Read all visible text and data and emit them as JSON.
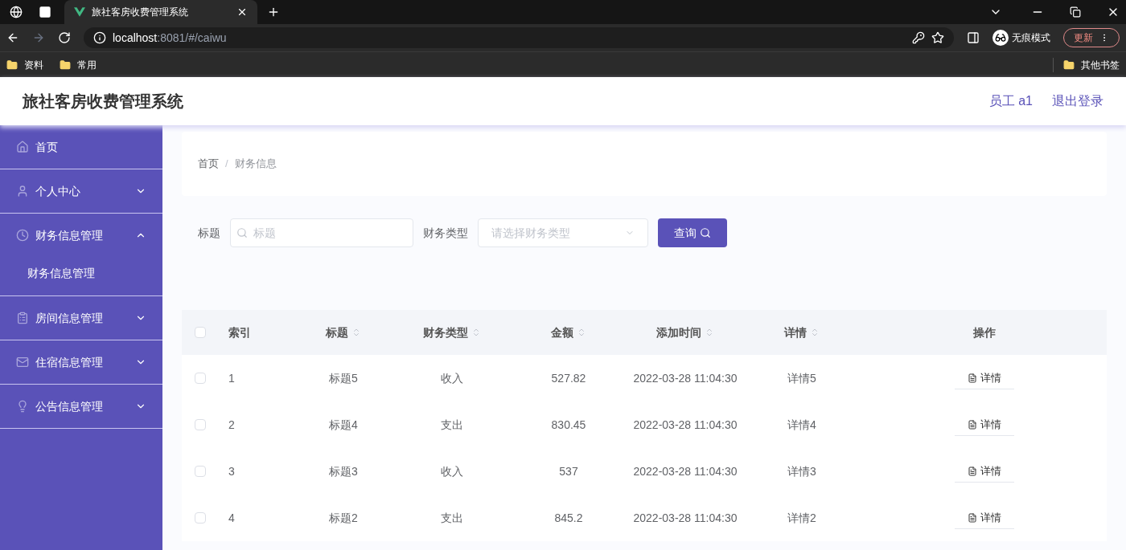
{
  "browser": {
    "tab_title": "旅社客房收费管理系统",
    "address": {
      "host": "localhost",
      "path": ":8081/#/caiwu"
    },
    "profile": "无痕模式",
    "update": "更新",
    "bookmarks": [
      "资料",
      "常用"
    ],
    "other_bookmarks": "其他书签"
  },
  "header": {
    "title": "旅社客房收费管理系统",
    "user": "员工 a1",
    "logout": "退出登录"
  },
  "sidebar": {
    "items": [
      {
        "label": "首页",
        "kind": "link"
      },
      {
        "label": "个人中心",
        "kind": "submenu",
        "expanded": false
      },
      {
        "label": "财务信息管理",
        "kind": "submenu",
        "expanded": true,
        "children": [
          {
            "label": "财务信息管理"
          }
        ]
      },
      {
        "label": "房间信息管理",
        "kind": "submenu",
        "expanded": false
      },
      {
        "label": "住宿信息管理",
        "kind": "submenu",
        "expanded": false
      },
      {
        "label": "公告信息管理",
        "kind": "submenu",
        "expanded": false
      }
    ]
  },
  "breadcrumb": {
    "items": [
      "首页",
      "财务信息"
    ],
    "separator": "/"
  },
  "search": {
    "title_label": "标题",
    "title_placeholder": "标题",
    "type_label": "财务类型",
    "type_placeholder": "请选择财务类型",
    "button": "查询"
  },
  "table": {
    "all_checked": false,
    "columns": [
      {
        "label": "索引",
        "sortable": false
      },
      {
        "label": "标题",
        "sortable": true
      },
      {
        "label": "财务类型",
        "sortable": true
      },
      {
        "label": "金额",
        "sortable": true
      },
      {
        "label": "添加时间",
        "sortable": true
      },
      {
        "label": "详情",
        "sortable": true
      },
      {
        "label": "操作",
        "sortable": false
      }
    ],
    "rows": [
      {
        "checked": false,
        "cells": [
          "1",
          "标题5",
          "收入",
          "527.82",
          "2022-03-28 11:04:30",
          "详情5"
        ],
        "action": "详情"
      },
      {
        "checked": false,
        "cells": [
          "2",
          "标题4",
          "支出",
          "830.45",
          "2022-03-28 11:04:30",
          "详情4"
        ],
        "action": "详情"
      },
      {
        "checked": false,
        "cells": [
          "3",
          "标题3",
          "收入",
          "537",
          "2022-03-28 11:04:30",
          "详情3"
        ],
        "action": "详情"
      },
      {
        "checked": false,
        "cells": [
          "4",
          "标题2",
          "支出",
          "845.2",
          "2022-03-28 11:04:30",
          "详情2"
        ],
        "action": "详情"
      }
    ]
  }
}
